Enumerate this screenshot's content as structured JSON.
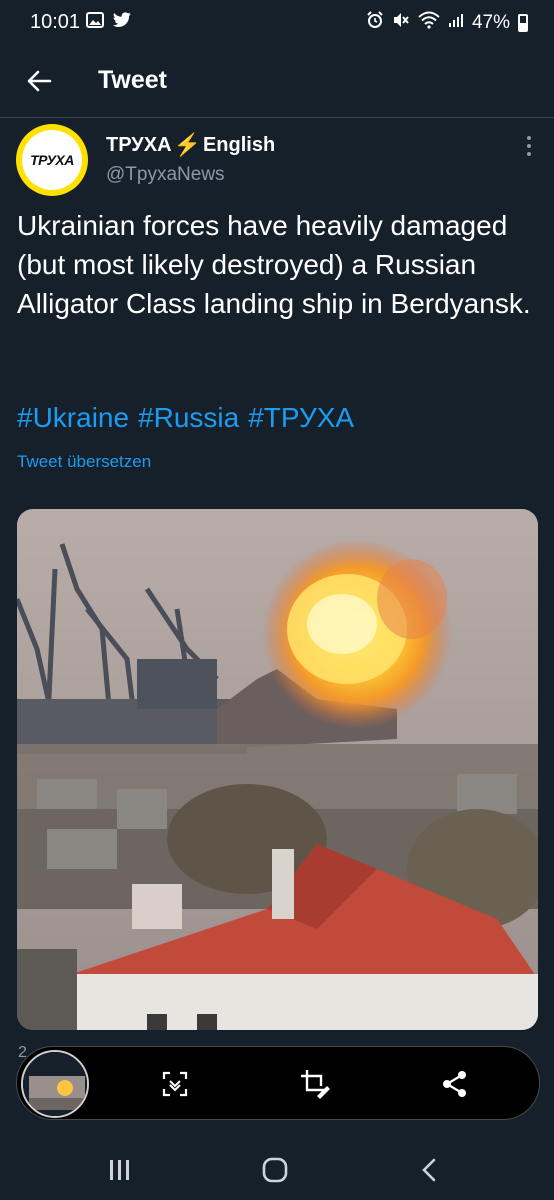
{
  "status_bar": {
    "time": "10:01",
    "battery": "47%",
    "battery_level": 0.47,
    "left_icons": [
      "gallery-icon",
      "twitter-icon"
    ],
    "right_icons": [
      "alarm-icon",
      "mute-icon",
      "wifi-icon",
      "signal-icon",
      "battery-icon"
    ]
  },
  "header": {
    "title": "Tweet",
    "back_icon": "arrow-left-icon"
  },
  "tweet": {
    "author": {
      "name": "ТРУХА",
      "name_suffix": "English",
      "name_emoji": "⚡",
      "handle": "@TpyxaNews",
      "avatar_text": "ТРУХА"
    },
    "text": "Ukrainian forces have heavily damaged (but most likely destroyed) a Russian Alligator Class landing ship in Berdyansk.",
    "hashtags": [
      "#Ukraine",
      "#Russia",
      "#ТРУХА"
    ],
    "translate_label": "Tweet übersetzen",
    "stat_partial": "2"
  },
  "screenshot_toolbar": {
    "scroll_icon": "scroll-capture-icon",
    "crop_icon": "crop-edit-icon",
    "share_icon": "share-icon"
  },
  "nav_bar": {
    "recent_icon": "recent-apps-icon",
    "home_icon": "home-icon",
    "back_icon": "back-icon"
  },
  "colors": {
    "background": "#15202b",
    "accent": "#1d9bf0",
    "secondary_text": "#8b98a5",
    "divider": "#38444d"
  }
}
